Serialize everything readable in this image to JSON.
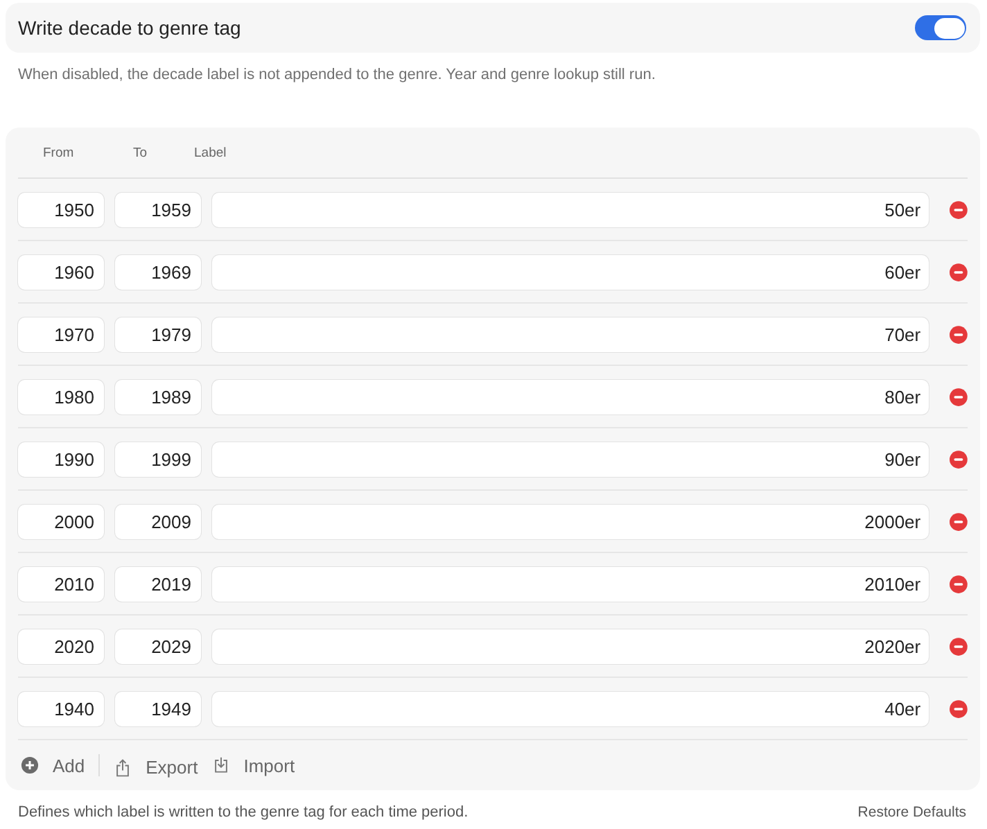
{
  "setting": {
    "label": "Write decade to genre tag",
    "on": true
  },
  "description": "When disabled, the decade label is not appended to the genre. Year and genre lookup still run.",
  "table": {
    "columns": [
      "From",
      "To",
      "Label"
    ],
    "rows": [
      {
        "from": "1950",
        "to": "1959",
        "label": "50er"
      },
      {
        "from": "1960",
        "to": "1969",
        "label": "60er"
      },
      {
        "from": "1970",
        "to": "1979",
        "label": "70er"
      },
      {
        "from": "1980",
        "to": "1989",
        "label": "80er"
      },
      {
        "from": "1990",
        "to": "1999",
        "label": "90er"
      },
      {
        "from": "2000",
        "to": "2009",
        "label": "2000er"
      },
      {
        "from": "2010",
        "to": "2019",
        "label": "2010er"
      },
      {
        "from": "2020",
        "to": "2029",
        "label": "2020er"
      },
      {
        "from": "1940",
        "to": "1949",
        "label": "40er"
      }
    ],
    "actions": [
      {
        "kind": "add",
        "label": "Add"
      },
      {
        "kind": "export",
        "label": "Export"
      },
      {
        "kind": "import",
        "label": "Import"
      }
    ]
  },
  "footer": {
    "note": "Defines which label is written to the genre tag for each time period.",
    "restore": "Restore Defaults"
  }
}
